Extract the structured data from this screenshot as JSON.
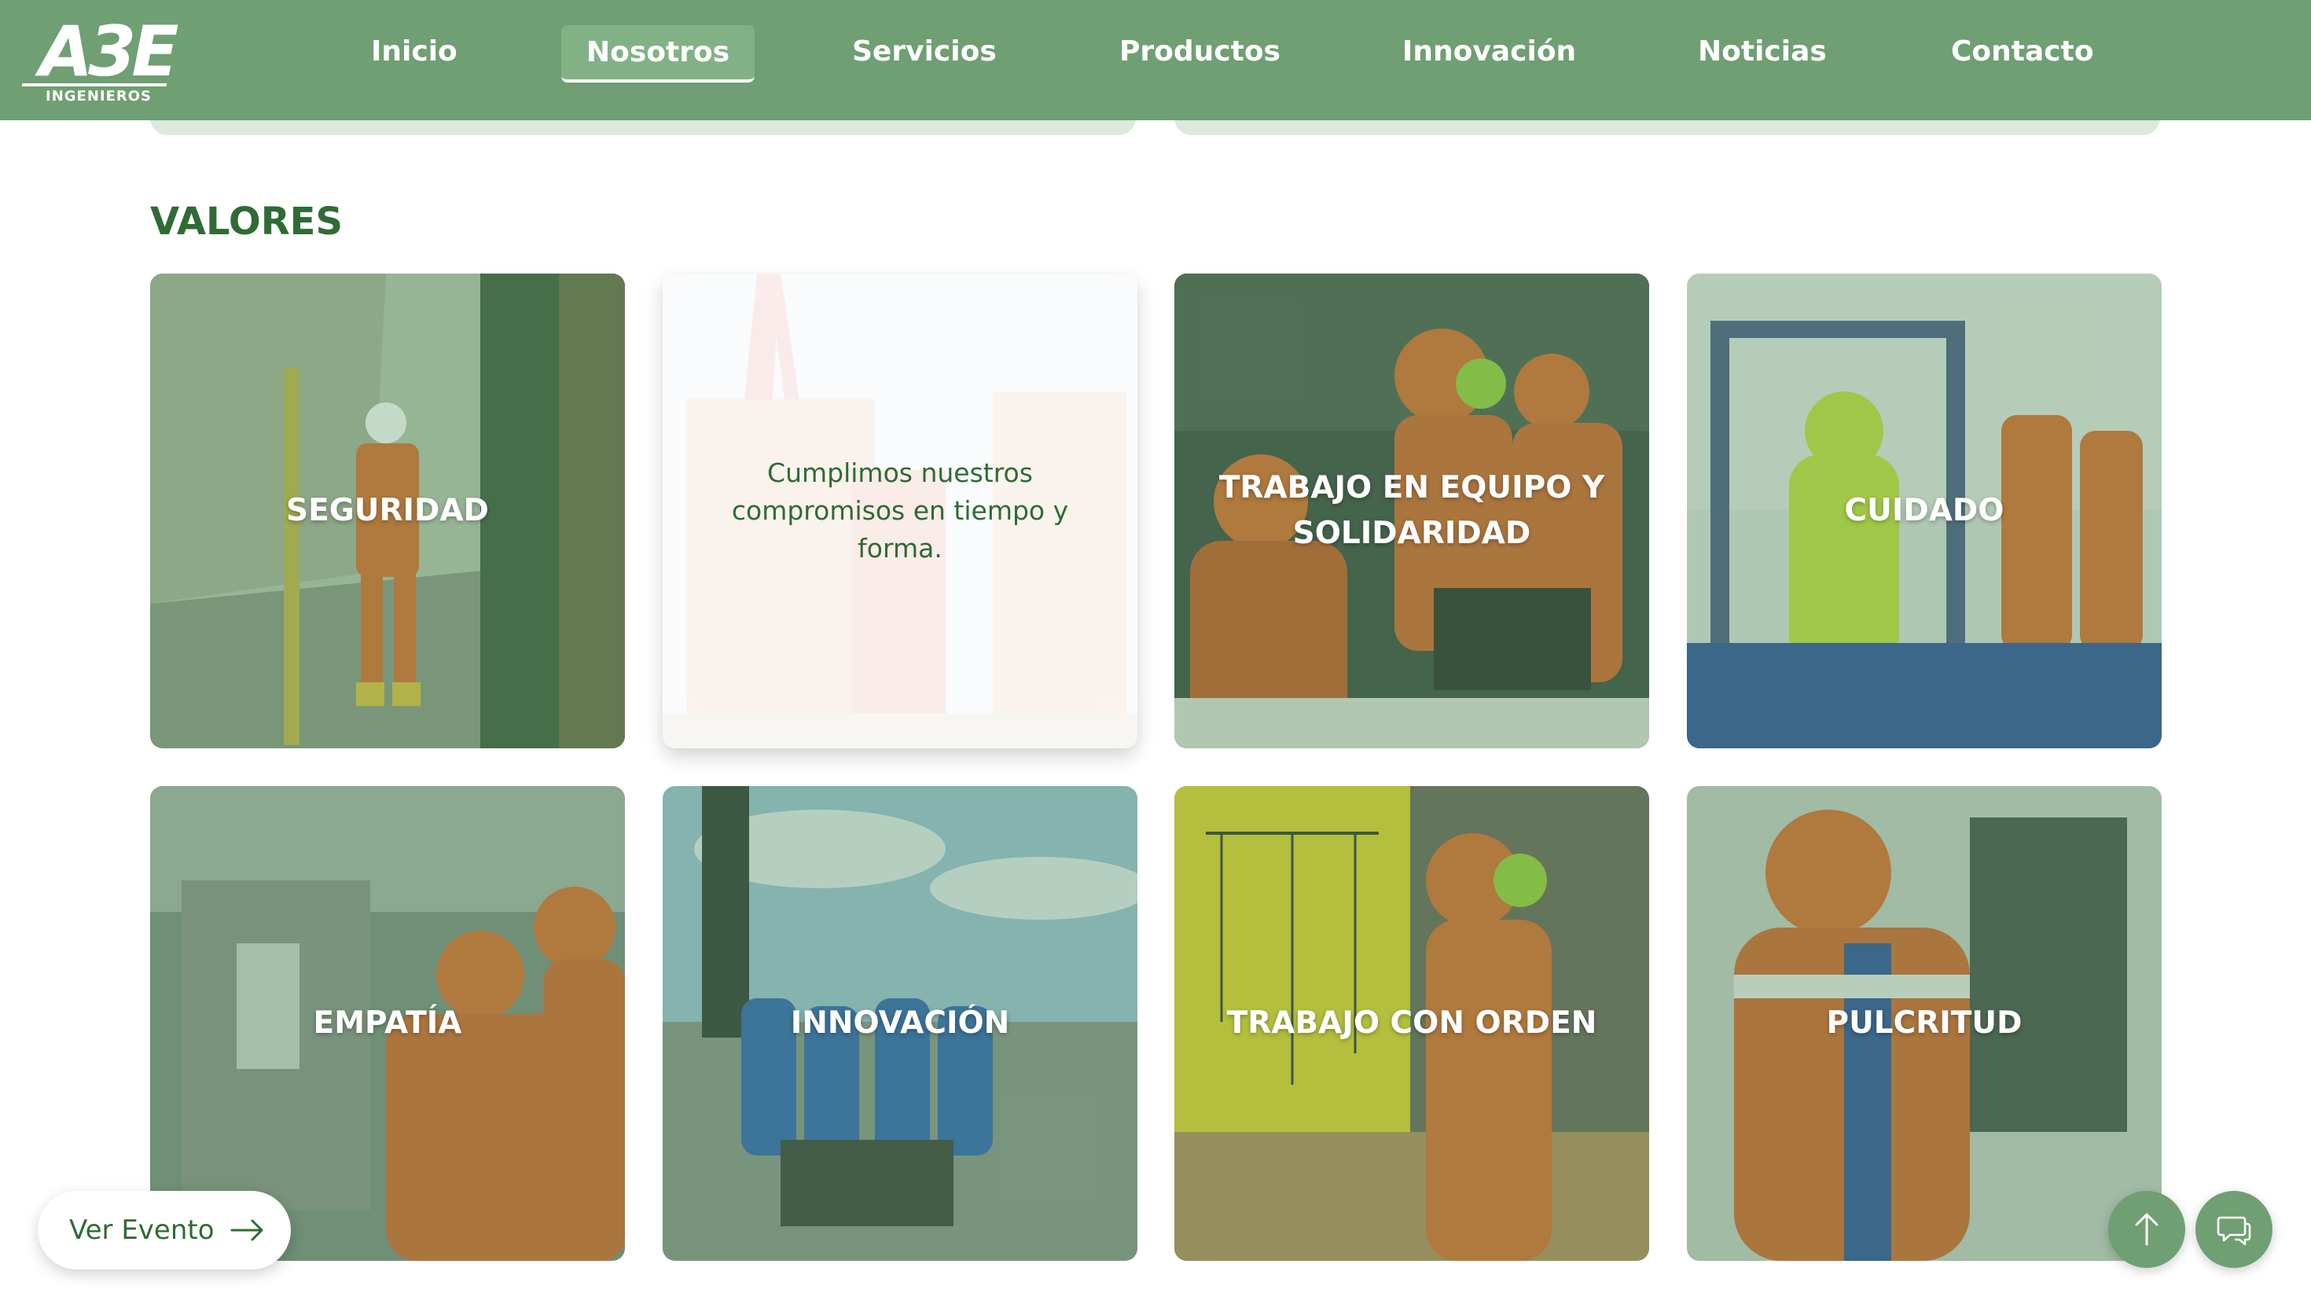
{
  "brand": {
    "logo_text": "A3E",
    "logo_sub": "INGENIEROS"
  },
  "nav": {
    "items": [
      {
        "label": "Inicio"
      },
      {
        "label": "Nosotros",
        "active": true
      },
      {
        "label": "Servicios"
      },
      {
        "label": "Productos"
      },
      {
        "label": "Innovación"
      },
      {
        "label": "Noticias"
      },
      {
        "label": "Contacto"
      }
    ]
  },
  "section": {
    "title": "VALORES"
  },
  "values": [
    {
      "label": "SEGURIDAD",
      "scene": "worker-slope"
    },
    {
      "label": "Cumplimos nuestros compromisos en tiempo y forma.",
      "scene": "structure",
      "state": "flipped"
    },
    {
      "label": "TRABAJO EN EQUIPO Y SOLIDARIDAD",
      "scene": "team-laptop"
    },
    {
      "label": "CUIDADO",
      "scene": "hazmat"
    },
    {
      "label": "EMPATÍA",
      "scene": "electrical-panel"
    },
    {
      "label": "INNOVACIÓN",
      "scene": "team-vehicle"
    },
    {
      "label": "TRABAJO CON ORDEN",
      "scene": "diagram-board"
    },
    {
      "label": "PULCRITUD",
      "scene": "electrician"
    }
  ],
  "floating": {
    "event_label": "Ver Evento",
    "event_icon": "arrow-right-icon",
    "top_icon": "arrow-up-icon",
    "chat_icon": "chat-icon"
  },
  "colors": {
    "header_bg": "#6f9f72",
    "title_green": "#2f6b34",
    "card_overlay": "#569660",
    "accent_orange": "#e06a2a"
  }
}
